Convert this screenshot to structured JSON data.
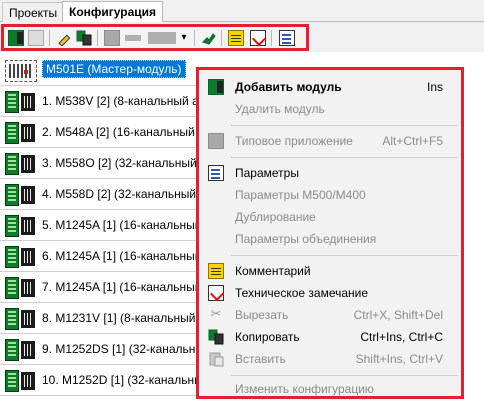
{
  "tabs": {
    "projects": "Проекты",
    "configuration": "Конфигурация"
  },
  "toolbar": {
    "icons": [
      "add-module-icon",
      "remove-module-icon",
      "pencil-icon",
      "copy-icon",
      "module-gray-icon",
      "bar-gray-icon",
      "block-gray-icon",
      "dropdown-arrow-icon",
      "plugin-icon",
      "comment-icon",
      "note-icon",
      "parameters-icon"
    ],
    "dropdown_glyph": "▾"
  },
  "modules": [
    {
      "label": "M501E (Мастер-модуль)",
      "selected": true
    },
    {
      "label": "1. M538V [2] (8-канальный ан"
    },
    {
      "label": "2. M548A [2] (16-канальный"
    },
    {
      "label": "3. M558O [2] (32-канальный"
    },
    {
      "label": "4. M558D [2] (32-канальный"
    },
    {
      "label": "5. M1245A [1] (16-канальный"
    },
    {
      "label": "6. M1245A [1] (16-канальный"
    },
    {
      "label": "7. M1245A [1] (16-канальный"
    },
    {
      "label": "8. M1231V [1] (8-канальный"
    },
    {
      "label": "9. M1252DS [1] (32-канальный"
    },
    {
      "label": "10. M1252D [1] (32-канальный"
    }
  ],
  "context_menu": {
    "add_module": {
      "label": "Добавить модуль",
      "shortcut": "Ins"
    },
    "remove_module": {
      "label": "Удалить модуль"
    },
    "typical_app": {
      "label": "Типовое приложение",
      "shortcut": "Alt+Ctrl+F5"
    },
    "parameters": {
      "label": "Параметры"
    },
    "parameters_m500": {
      "label": "Параметры M500/M400"
    },
    "duplicate": {
      "label": "Дублирование"
    },
    "merge_params": {
      "label": "Параметры объединения"
    },
    "comment": {
      "label": "Комментарий"
    },
    "tech_note": {
      "label": "Техническое замечание"
    },
    "cut": {
      "label": "Вырезать",
      "shortcut": "Ctrl+X, Shift+Del",
      "icon_glyph": "✂"
    },
    "copy": {
      "label": "Копировать",
      "shortcut": "Ctrl+Ins, Ctrl+C"
    },
    "paste": {
      "label": "Вставить",
      "shortcut": "Shift+Ins, Ctrl+V"
    },
    "change_config": {
      "label": "Изменить конфигурацию"
    }
  },
  "colors": {
    "highlight": "#e0222e",
    "selection": "#0078d7",
    "board_green": "#0f7a2a"
  }
}
